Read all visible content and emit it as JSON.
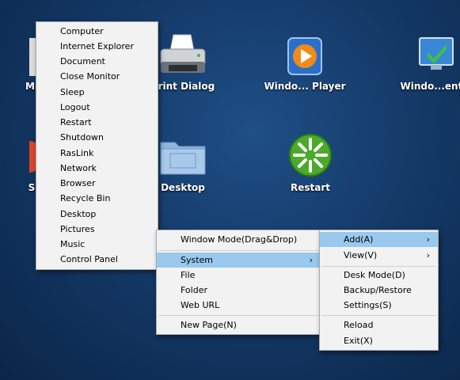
{
  "desktop_icons": [
    {
      "label": "Mi",
      "icon": "partial-icon"
    },
    {
      "label": "Print Dialog",
      "icon": "printer-icon"
    },
    {
      "label": "Windo... Player",
      "icon": "media-player-icon"
    },
    {
      "label": "Windo...entia",
      "icon": "monitor-icon"
    },
    {
      "label": "S",
      "icon": "partial-icon"
    },
    {
      "label": "Desktop",
      "icon": "folder-icon"
    },
    {
      "label": "Restart",
      "icon": "restart-icon"
    }
  ],
  "quick_menu": {
    "items": [
      "Computer",
      "Internet Explorer",
      "Document",
      "Close Monitor",
      "Sleep",
      "Logout",
      "Restart",
      "Shutdown",
      "RasLink",
      "Network",
      "Browser",
      "Recycle Bin",
      "Desktop",
      "Pictures",
      "Music",
      "Control Panel"
    ]
  },
  "context_menu": {
    "window_mode": "Window Mode(Drag&Drop)",
    "system": "System",
    "file": "File",
    "folder": "Folder",
    "web_url": "Web URL",
    "new_page": "New Page(N)"
  },
  "submenu": {
    "add": "Add(A)",
    "view": "View(V)",
    "desk_mode": "Desk Mode(D)",
    "backup": "Backup/Restore",
    "settings": "Settings(S)",
    "reload": "Reload",
    "exit": "Exit(X)"
  },
  "colors": {
    "highlight": "#99c9ef",
    "menu_bg": "#f2f2f2"
  }
}
